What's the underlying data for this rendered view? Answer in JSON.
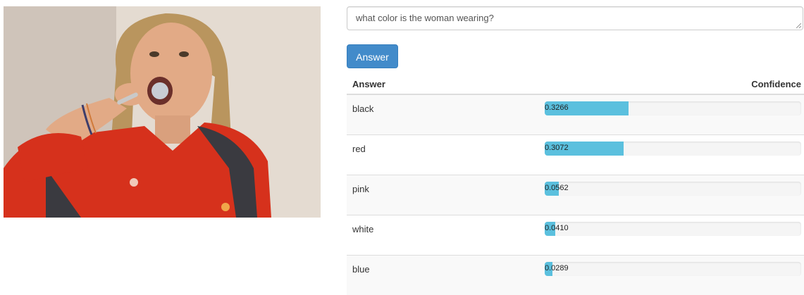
{
  "question": {
    "value": "what color is the woman wearing?"
  },
  "answer_button": {
    "label": "Answer"
  },
  "table": {
    "col_answer": "Answer",
    "col_confidence": "Confidence",
    "rows": [
      {
        "answer": "black",
        "confidence": 0.3266,
        "confidence_text": "0.3266"
      },
      {
        "answer": "red",
        "confidence": 0.3072,
        "confidence_text": "0.3072"
      },
      {
        "answer": "pink",
        "confidence": 0.0562,
        "confidence_text": "0.0562"
      },
      {
        "answer": "white",
        "confidence": 0.041,
        "confidence_text": "0.0410"
      },
      {
        "answer": "blue",
        "confidence": 0.0289,
        "confidence_text": "0.0289"
      }
    ]
  },
  "colors": {
    "primary_button": "#428bca",
    "progress_fill": "#5bc0de",
    "progress_track": "#f5f5f5"
  }
}
